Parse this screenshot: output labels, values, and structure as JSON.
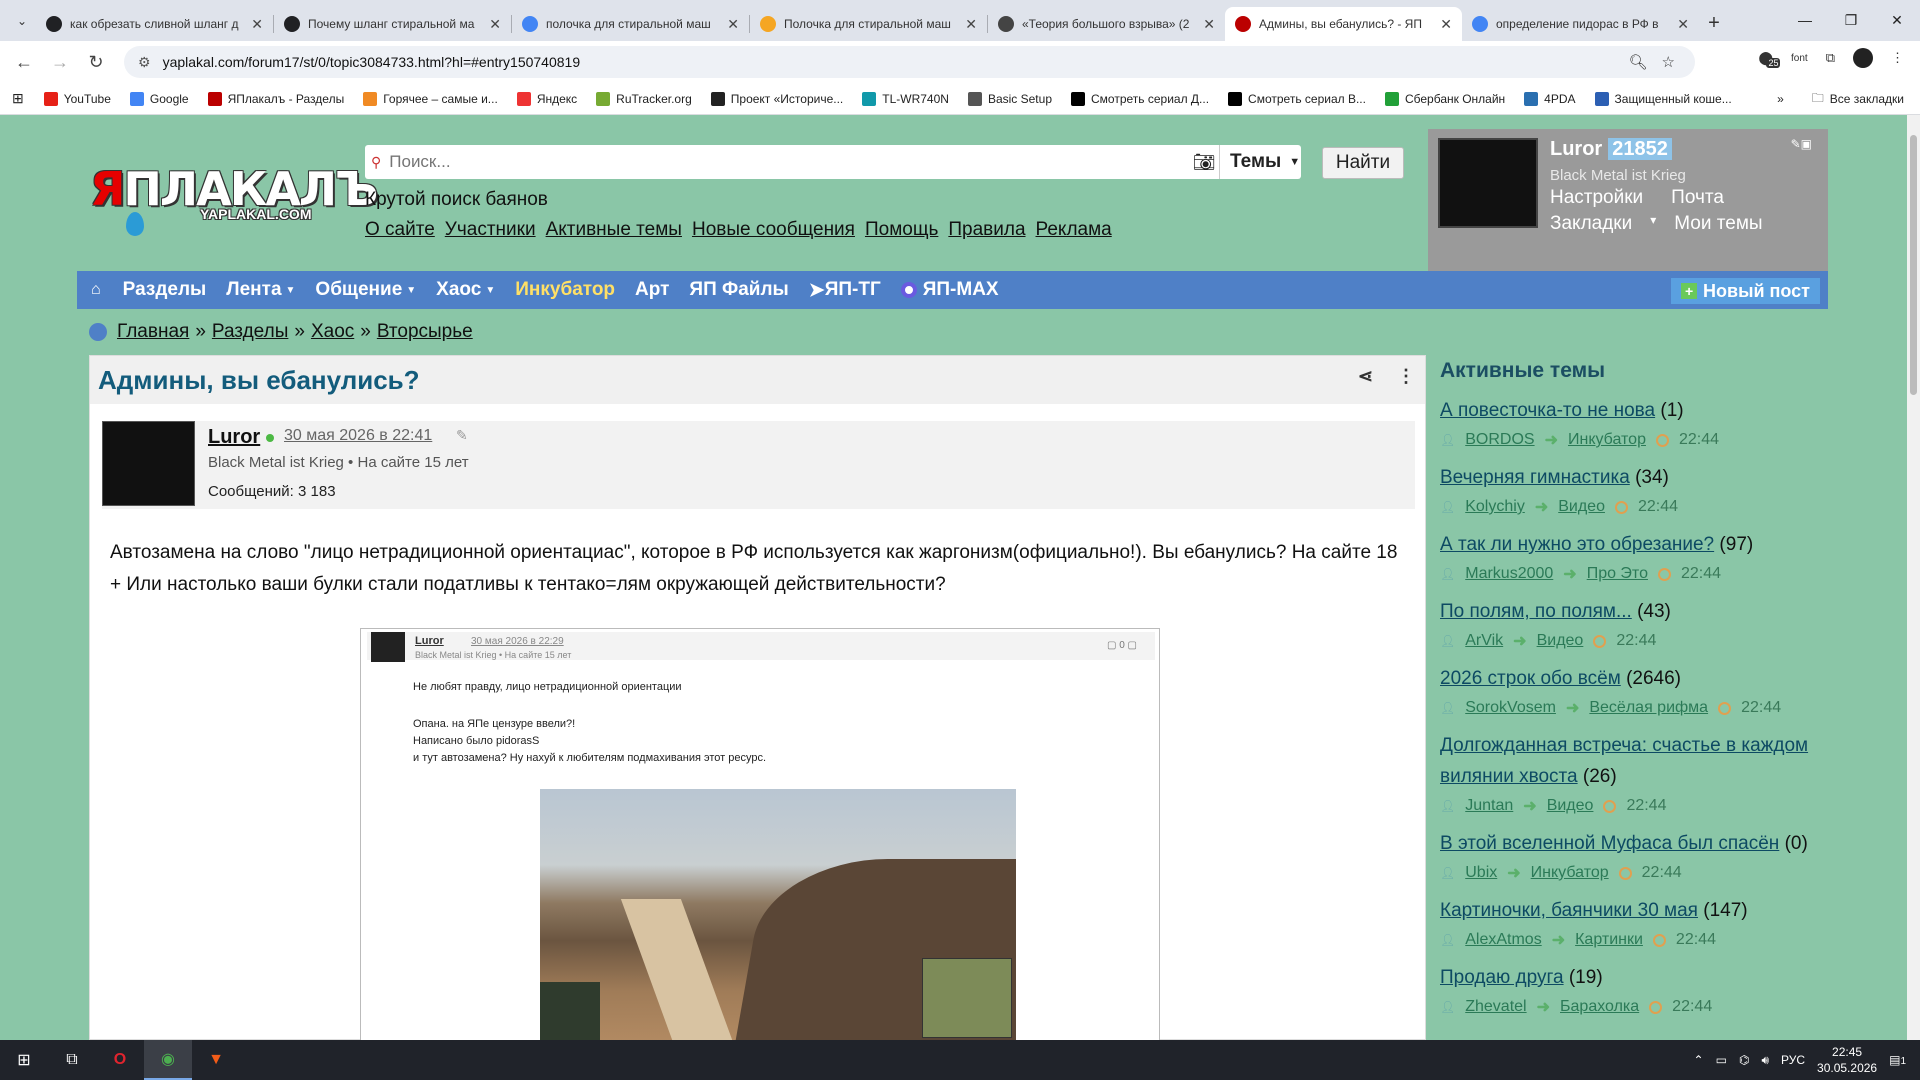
{
  "browser": {
    "tabs": [
      {
        "title": "как обрезать сливной шланг д",
        "icon": "plus-favicon",
        "active": false
      },
      {
        "title": "Почему шланг стиральной ма",
        "icon": "plus-favicon",
        "active": false
      },
      {
        "title": "полочка для стиральной маш",
        "icon": "google-favicon",
        "active": false
      },
      {
        "title": "Полочка для стиральной маш",
        "icon": "market-favicon",
        "active": false
      },
      {
        "title": "«Теория большого взрыва» (2",
        "icon": "kinopoisk-favicon",
        "active": false
      },
      {
        "title": "Админы, вы ебанулись? - ЯП",
        "icon": "yaplakal-favicon",
        "active": true
      },
      {
        "title": "определение пидорас в РФ в",
        "icon": "google-favicon",
        "active": false
      }
    ],
    "url": "yaplakal.com/forum17/st/0/topic3084733.html?hl=#entry150740819",
    "extension_badge": "25",
    "extension_label": "font",
    "bookmarks": [
      {
        "label": "YouTube",
        "icon": "youtube-icon",
        "color": "#e62117"
      },
      {
        "label": "Google",
        "icon": "google-icon",
        "color": "#4285f4"
      },
      {
        "label": "ЯПлакалъ - Разделы",
        "icon": "yaplakal-icon",
        "color": "#b00"
      },
      {
        "label": "Горячее – самые и...",
        "icon": "pikabu-icon",
        "color": "#f08a24"
      },
      {
        "label": "Яндекс",
        "icon": "yandex-icon",
        "color": "#e33"
      },
      {
        "label": "RuTracker.org",
        "icon": "rutracker-icon",
        "color": "#7a3"
      },
      {
        "label": "Проект «Историче...",
        "icon": "project-icon",
        "color": "#222"
      },
      {
        "label": "TL-WR740N",
        "icon": "tplink-icon",
        "color": "#19a"
      },
      {
        "label": "Basic Setup",
        "icon": "globe-icon",
        "color": "#555"
      },
      {
        "label": "Смотреть сериал Д...",
        "icon": "hd-icon",
        "color": "#000"
      },
      {
        "label": "Смотреть сериал В...",
        "icon": "hd-icon",
        "color": "#000"
      },
      {
        "label": "Сбербанк Онлайн",
        "icon": "sber-icon",
        "color": "#21a038"
      },
      {
        "label": "4PDA",
        "icon": "4pda-icon",
        "color": "#2a6fb0"
      },
      {
        "label": "Защищенный коше...",
        "icon": "wallet-icon",
        "color": "#2c5fb3"
      }
    ],
    "all_bookmarks": "Все закладки"
  },
  "site": {
    "logo_text": "ЯПЛАКАЛЪ",
    "logo_sub": "YAPLAKAL.COM",
    "search_placeholder": "Поиск...",
    "themes_label": "Темы",
    "find_button": "Найти",
    "tagline": "Крутой поиск баянов",
    "top_links": [
      "О сайте",
      "Участники",
      "Активные темы",
      "Новые сообщения",
      "Помощь",
      "Правила",
      "Реклама"
    ],
    "user": {
      "name": "Luror",
      "points": "21852",
      "status": "Black Metal ist Krieg",
      "links_row1": [
        "Настройки",
        "Почта"
      ],
      "links_row2": [
        "Закладки",
        "Мои темы"
      ]
    },
    "nav": [
      {
        "label": "Разделы",
        "caret": false,
        "accent": false
      },
      {
        "label": "Лента",
        "caret": true,
        "accent": false
      },
      {
        "label": "Общение",
        "caret": true,
        "accent": false
      },
      {
        "label": "Хаос",
        "caret": true,
        "accent": false
      },
      {
        "label": "Инкубатор",
        "caret": false,
        "accent": true
      },
      {
        "label": "Арт",
        "caret": false,
        "accent": false
      },
      {
        "label": "ЯП Файлы",
        "caret": false,
        "accent": false
      },
      {
        "label": "ЯП-ТГ",
        "caret": false,
        "accent": false
      },
      {
        "label": "ЯП-MAX",
        "caret": false,
        "accent": false
      }
    ],
    "new_post": "Новый пост",
    "breadcrumb": [
      "Главная",
      "Разделы",
      "Хаос",
      "Вторсырье"
    ],
    "breadcrumb_sep": "»"
  },
  "topic": {
    "title": "Админы, вы ебанулись?",
    "post": {
      "author": "Luror",
      "date": "30 мая 2026 в 22:41",
      "status": "Black Metal ist Krieg",
      "online_since": "На сайте 15 лет",
      "messages": "Сообщений: 3 183",
      "text": "Автозамена на слово \"лицо нетрадиционной ориентациас\", которое в РФ используется как жаргонизм(официально!). Вы ебанулись? На сайте 18 + Или настолько ваши булки стали податливы к тентако=лям окружающей действительности?"
    },
    "embedded": {
      "author": "Luror",
      "date": "30 мая 2026 в 22:29",
      "status": "Black Metal ist Krieg • На сайте 15 лет",
      "count": "0",
      "line1": "Не любят правду, лицо нетрадиционной ориентации",
      "line2": "Опана. на ЯПе цензуре ввели?!",
      "line3": "Написано было pidorasS",
      "line4": "и тут автозамена? Ну нахуй к любителям подмахивания этот ресурс."
    }
  },
  "sidebar": {
    "heading": "Активные темы",
    "topics": [
      {
        "title": "А повесточка-то не нова",
        "count": "(1)",
        "author": "BORDOS",
        "section": "Инкубатор",
        "time": "22:44"
      },
      {
        "title": "Вечерняя гимнастика",
        "count": "(34)",
        "author": "Kolychiy",
        "section": "Видео",
        "time": "22:44"
      },
      {
        "title": "А так ли нужно это обрезание?",
        "count": "(97)",
        "author": "Markus2000",
        "section": "Про Это",
        "time": "22:44"
      },
      {
        "title": "По полям, по полям...",
        "count": "(43)",
        "author": "ArVik",
        "section": "Видео",
        "time": "22:44"
      },
      {
        "title": "2026 строк обо всём",
        "count": "(2646)",
        "author": "SorokVosem",
        "section": "Весёлая рифма",
        "time": "22:44"
      },
      {
        "title": "Долгожданная встреча: счастье в каждом вилянии хвоста",
        "count": "(26)",
        "author": "Juntan",
        "section": "Видео",
        "time": "22:44"
      },
      {
        "title": "В этой вселенной Муфаса был спасён",
        "count": "(0)",
        "author": "Ubix",
        "section": "Инкубатор",
        "time": "22:44"
      },
      {
        "title": "Картиночки, баянчики 30 мая",
        "count": "(147)",
        "author": "AlexAtmos",
        "section": "Картинки",
        "time": "22:44"
      },
      {
        "title": "Продаю друга",
        "count": "(19)",
        "author": "Zhevatel",
        "section": "Барахолка",
        "time": "22:44"
      }
    ]
  },
  "taskbar": {
    "lang": "РУС",
    "time": "22:45",
    "date": "30.05.2026",
    "notifications": "1"
  }
}
